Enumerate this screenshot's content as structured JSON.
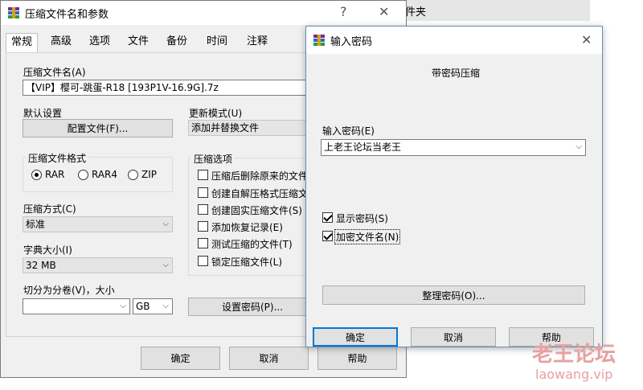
{
  "background_window": {
    "partial_title": "件夹"
  },
  "main_dialog": {
    "title": "压缩文件名和参数",
    "help_glyph": "?",
    "close_glyph": "✕",
    "tabs": [
      "常规",
      "高级",
      "选项",
      "文件",
      "备份",
      "时间",
      "注释"
    ],
    "archive_name_label": "压缩文件名(A)",
    "archive_name_value": "【VIP】樱可-跳蛋-R18 [193P1V-16.9G].7z",
    "default_settings_label": "默认设置",
    "profile_button": "配置文件(F)...",
    "update_mode_label": "更新模式(U)",
    "update_mode_value": "添加并替换文件",
    "format_group_title": "压缩文件格式",
    "format_options": [
      "RAR",
      "RAR4",
      "ZIP"
    ],
    "format_selected": "RAR",
    "options_group_title": "压缩选项",
    "options": [
      {
        "label": "压缩后删除原来的文件",
        "checked": false
      },
      {
        "label": "创建自解压格式压缩文",
        "checked": false
      },
      {
        "label": "创建固实压缩文件(S)",
        "checked": false
      },
      {
        "label": "添加恢复记录(E)",
        "checked": false
      },
      {
        "label": "测试压缩的文件(T)",
        "checked": false
      },
      {
        "label": "锁定压缩文件(L)",
        "checked": false
      }
    ],
    "method_label": "压缩方式(C)",
    "method_value": "标准",
    "dict_label": "字典大小(I)",
    "dict_value": "32 MB",
    "split_label": "切分为分卷(V)，大小",
    "split_value": "",
    "split_unit": "GB",
    "set_password_button": "设置密码(P)...",
    "ok_button": "确定",
    "cancel_button": "取消",
    "help_button": "帮助"
  },
  "password_dialog": {
    "title": "输入密码",
    "close_glyph": "✕",
    "subtitle": "带密码压缩",
    "enter_label": "输入密码(E)",
    "password_value": "上老王论坛当老王",
    "show_password": {
      "label": "显示密码(S)",
      "checked": true
    },
    "encrypt_names": {
      "label": "加密文件名(N)",
      "checked": true
    },
    "organize_button": "整理密码(O)...",
    "ok_button": "确定",
    "cancel_button": "取消",
    "help_button": "帮助"
  },
  "watermark": {
    "line1": "老王论坛",
    "line2": "laowang.vip"
  },
  "colors": {
    "dialog_bg": "#f0f0f0",
    "focus_border": "#0078d7",
    "watermark": "#e8a0a0"
  },
  "icons": [
    "winrar-app-icon",
    "winrar-app-icon",
    "chevron-down-icon",
    "close-icon",
    "help-icon"
  ]
}
